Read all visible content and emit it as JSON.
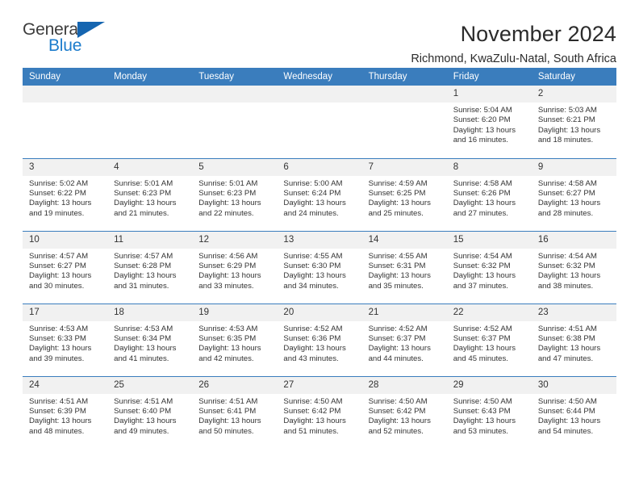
{
  "branding": {
    "logo_primary": "General",
    "logo_secondary": "Blue",
    "accent_color": "#1565b0",
    "logo_text_color": "#3d3d3d",
    "logo_blue_color": "#1c7ccc"
  },
  "header": {
    "title": "November 2024",
    "subtitle": "Richmond, KwaZulu-Natal, South Africa",
    "header_bg_color": "#3a7dbd",
    "header_text_color": "#ffffff"
  },
  "weekday_headers": [
    "Sunday",
    "Monday",
    "Tuesday",
    "Wednesday",
    "Thursday",
    "Friday",
    "Saturday"
  ],
  "weeks": [
    [
      {
        "day": "",
        "info": "",
        "blank": true
      },
      {
        "day": "",
        "info": "",
        "blank": true
      },
      {
        "day": "",
        "info": "",
        "blank": true
      },
      {
        "day": "",
        "info": "",
        "blank": true
      },
      {
        "day": "",
        "info": "",
        "blank": true
      },
      {
        "day": "1",
        "info": "Sunrise: 5:04 AM\nSunset: 6:20 PM\nDaylight: 13 hours and 16 minutes."
      },
      {
        "day": "2",
        "info": "Sunrise: 5:03 AM\nSunset: 6:21 PM\nDaylight: 13 hours and 18 minutes."
      }
    ],
    [
      {
        "day": "3",
        "info": "Sunrise: 5:02 AM\nSunset: 6:22 PM\nDaylight: 13 hours and 19 minutes."
      },
      {
        "day": "4",
        "info": "Sunrise: 5:01 AM\nSunset: 6:23 PM\nDaylight: 13 hours and 21 minutes."
      },
      {
        "day": "5",
        "info": "Sunrise: 5:01 AM\nSunset: 6:23 PM\nDaylight: 13 hours and 22 minutes."
      },
      {
        "day": "6",
        "info": "Sunrise: 5:00 AM\nSunset: 6:24 PM\nDaylight: 13 hours and 24 minutes."
      },
      {
        "day": "7",
        "info": "Sunrise: 4:59 AM\nSunset: 6:25 PM\nDaylight: 13 hours and 25 minutes."
      },
      {
        "day": "8",
        "info": "Sunrise: 4:58 AM\nSunset: 6:26 PM\nDaylight: 13 hours and 27 minutes."
      },
      {
        "day": "9",
        "info": "Sunrise: 4:58 AM\nSunset: 6:27 PM\nDaylight: 13 hours and 28 minutes."
      }
    ],
    [
      {
        "day": "10",
        "info": "Sunrise: 4:57 AM\nSunset: 6:27 PM\nDaylight: 13 hours and 30 minutes."
      },
      {
        "day": "11",
        "info": "Sunrise: 4:57 AM\nSunset: 6:28 PM\nDaylight: 13 hours and 31 minutes."
      },
      {
        "day": "12",
        "info": "Sunrise: 4:56 AM\nSunset: 6:29 PM\nDaylight: 13 hours and 33 minutes."
      },
      {
        "day": "13",
        "info": "Sunrise: 4:55 AM\nSunset: 6:30 PM\nDaylight: 13 hours and 34 minutes."
      },
      {
        "day": "14",
        "info": "Sunrise: 4:55 AM\nSunset: 6:31 PM\nDaylight: 13 hours and 35 minutes."
      },
      {
        "day": "15",
        "info": "Sunrise: 4:54 AM\nSunset: 6:32 PM\nDaylight: 13 hours and 37 minutes."
      },
      {
        "day": "16",
        "info": "Sunrise: 4:54 AM\nSunset: 6:32 PM\nDaylight: 13 hours and 38 minutes."
      }
    ],
    [
      {
        "day": "17",
        "info": "Sunrise: 4:53 AM\nSunset: 6:33 PM\nDaylight: 13 hours and 39 minutes."
      },
      {
        "day": "18",
        "info": "Sunrise: 4:53 AM\nSunset: 6:34 PM\nDaylight: 13 hours and 41 minutes."
      },
      {
        "day": "19",
        "info": "Sunrise: 4:53 AM\nSunset: 6:35 PM\nDaylight: 13 hours and 42 minutes."
      },
      {
        "day": "20",
        "info": "Sunrise: 4:52 AM\nSunset: 6:36 PM\nDaylight: 13 hours and 43 minutes."
      },
      {
        "day": "21",
        "info": "Sunrise: 4:52 AM\nSunset: 6:37 PM\nDaylight: 13 hours and 44 minutes."
      },
      {
        "day": "22",
        "info": "Sunrise: 4:52 AM\nSunset: 6:37 PM\nDaylight: 13 hours and 45 minutes."
      },
      {
        "day": "23",
        "info": "Sunrise: 4:51 AM\nSunset: 6:38 PM\nDaylight: 13 hours and 47 minutes."
      }
    ],
    [
      {
        "day": "24",
        "info": "Sunrise: 4:51 AM\nSunset: 6:39 PM\nDaylight: 13 hours and 48 minutes."
      },
      {
        "day": "25",
        "info": "Sunrise: 4:51 AM\nSunset: 6:40 PM\nDaylight: 13 hours and 49 minutes."
      },
      {
        "day": "26",
        "info": "Sunrise: 4:51 AM\nSunset: 6:41 PM\nDaylight: 13 hours and 50 minutes."
      },
      {
        "day": "27",
        "info": "Sunrise: 4:50 AM\nSunset: 6:42 PM\nDaylight: 13 hours and 51 minutes."
      },
      {
        "day": "28",
        "info": "Sunrise: 4:50 AM\nSunset: 6:42 PM\nDaylight: 13 hours and 52 minutes."
      },
      {
        "day": "29",
        "info": "Sunrise: 4:50 AM\nSunset: 6:43 PM\nDaylight: 13 hours and 53 minutes."
      },
      {
        "day": "30",
        "info": "Sunrise: 4:50 AM\nSunset: 6:44 PM\nDaylight: 13 hours and 54 minutes."
      }
    ]
  ]
}
